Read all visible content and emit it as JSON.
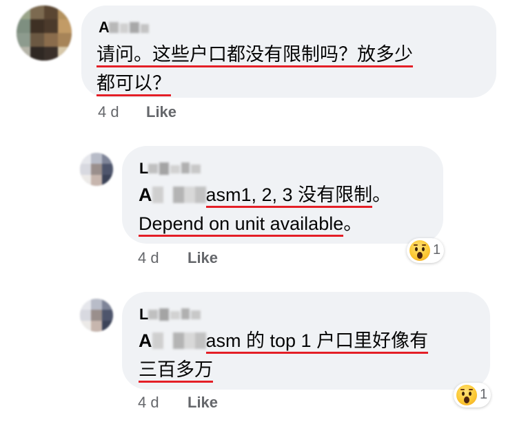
{
  "comments": [
    {
      "author": "A",
      "message_parts": [
        "请问。这些户口都没有限制吗？放多少",
        "都可以？"
      ],
      "time": "4 d",
      "like_label": "Like"
    },
    {
      "author": "L",
      "mention": "A",
      "message_parts": [
        "asm1, 2, 3 没有限制",
        "。",
        "Depend on unit available",
        "。"
      ],
      "time": "4 d",
      "like_label": "Like",
      "reaction": {
        "icon": "wow-emoji-icon",
        "count": "1"
      }
    },
    {
      "author": "L",
      "mention": "A",
      "message_parts": [
        "asm 的 top 1 户口里好像有",
        "三百多万"
      ],
      "time": "4 d",
      "like_label": "Like",
      "reaction": {
        "icon": "wow-emoji-icon",
        "count": "1"
      }
    }
  ],
  "colors": {
    "bubble": "#f0f2f5",
    "underline": "#e41e26",
    "meta_text": "#65676b",
    "text": "#050505"
  }
}
